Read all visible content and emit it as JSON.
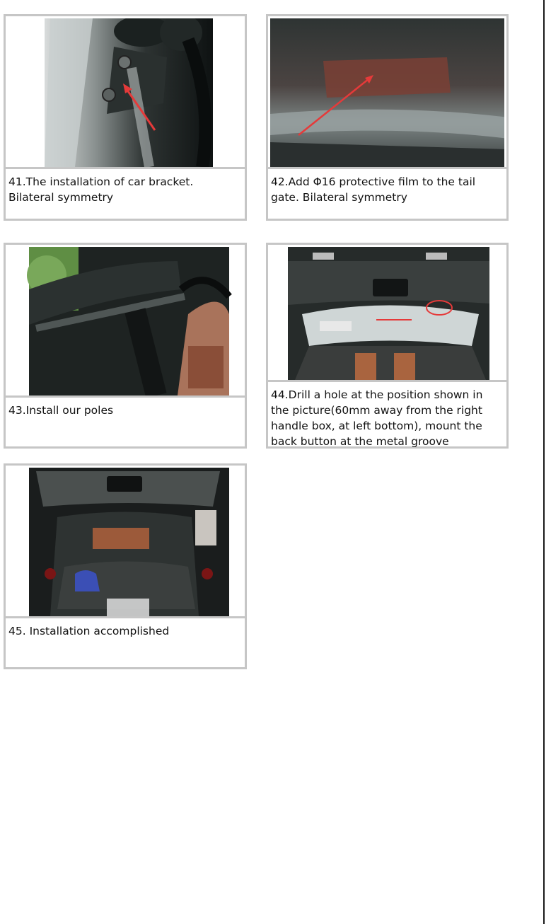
{
  "steps": [
    {
      "caption": "41.The installation of car bracket. Bilateral symmetry",
      "photo": "car-bracket-photo"
    },
    {
      "caption": "42.Add Φ16 protective film to the tail gate. Bilateral symmetry",
      "photo": "protective-film-photo"
    },
    {
      "caption": "43.Install our poles",
      "photo": "poles-photo"
    },
    {
      "caption": "44.Drill a hole at the position shown in the picture(60mm away from the right handle box, at left bottom), mount the back button at the metal groove",
      "photo": "drill-hole-photo"
    },
    {
      "caption": "45.  Installation accomplished",
      "photo": "installation-complete-photo"
    }
  ],
  "colors": {
    "border": "#c6c6c6",
    "annotation": "#e53a3a"
  }
}
